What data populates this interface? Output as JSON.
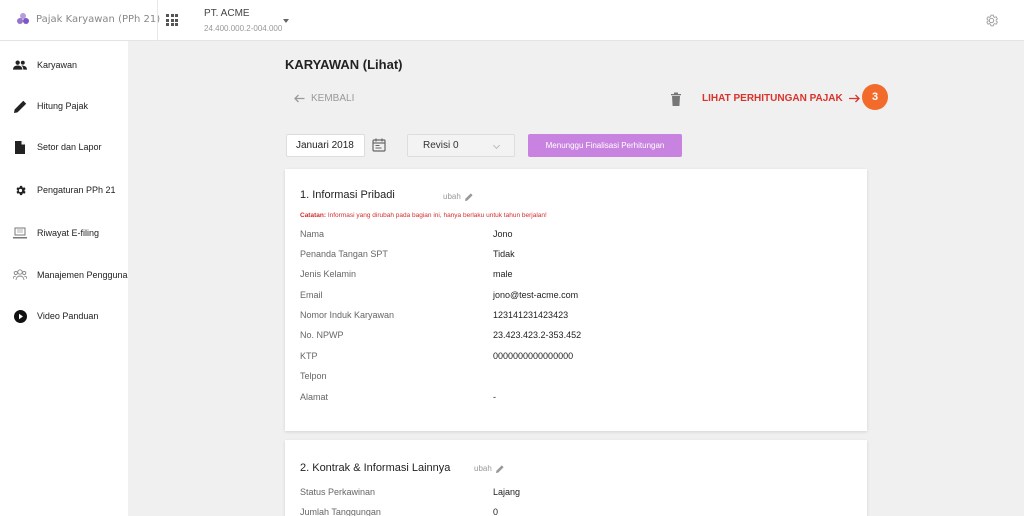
{
  "topbar": {
    "app_title": "Pajak Karyawan (PPh 21)",
    "company_name": "PT. ACME",
    "company_npwp": "24.400.000.2-004.000"
  },
  "sidebar": {
    "items": [
      {
        "label": "Karyawan",
        "icon": "people-icon"
      },
      {
        "label": "Hitung Pajak",
        "icon": "pencil-icon"
      },
      {
        "label": "Setor dan Lapor",
        "icon": "document-icon"
      },
      {
        "label": "Pengaturan PPh 21",
        "icon": "gear-icon"
      },
      {
        "label": "Riwayat E-filing",
        "icon": "laptop-icon"
      },
      {
        "label": "Manajemen Pengguna",
        "icon": "users-icon"
      },
      {
        "label": "Video Panduan",
        "icon": "play-icon"
      }
    ]
  },
  "page": {
    "title": "KARYAWAN (Lihat)",
    "back_label": "KEMBALI",
    "lihat_label": "LIHAT PERHITUNGAN PAJAK",
    "badge": "3",
    "period": "Januari 2018",
    "revisi": "Revisi 0",
    "status_button": "Menunggu Finalisasi Perhitungan"
  },
  "section1": {
    "title": "1. Informasi Pribadi",
    "edit_label": "ubah",
    "note_prefix": "Catatan:",
    "note_text": " Informasi yang dirubah pada bagian ini, hanya berlaku untuk tahun berjalan!",
    "fields": [
      {
        "label": "Nama",
        "value": "Jono"
      },
      {
        "label": "Penanda Tangan SPT",
        "value": "Tidak"
      },
      {
        "label": "Jenis Kelamin",
        "value": "male"
      },
      {
        "label": "Email",
        "value": "jono@test-acme.com"
      },
      {
        "label": "Nomor Induk Karyawan",
        "value": "123141231423423"
      },
      {
        "label": "No. NPWP",
        "value": "23.423.423.2-353.452"
      },
      {
        "label": "KTP",
        "value": "0000000000000000"
      },
      {
        "label": "Telpon",
        "value": ""
      },
      {
        "label": "Alamat",
        "value": "-"
      }
    ]
  },
  "section2": {
    "title": "2. Kontrak & Informasi Lainnya",
    "edit_label": "ubah",
    "fields": [
      {
        "label": "Status Perkawinan",
        "value": "Lajang"
      },
      {
        "label": "Jumlah Tanggungan",
        "value": "0"
      }
    ]
  },
  "colors": {
    "accent_red": "#d9342b",
    "badge_orange": "#f26b2a",
    "status_purple": "#c882e0"
  }
}
